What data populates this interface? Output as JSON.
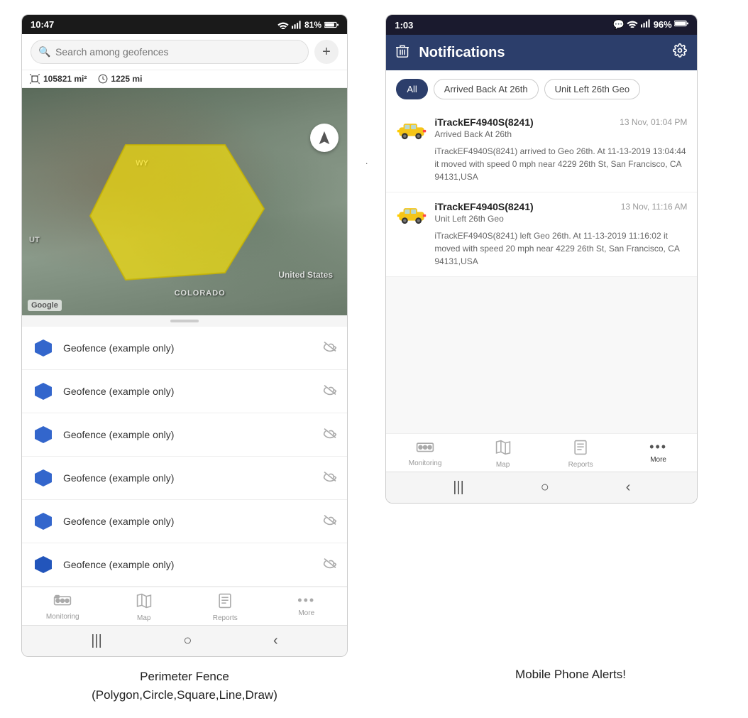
{
  "left_phone": {
    "status_bar": {
      "time": "10:47",
      "wifi": "WiFi",
      "signal": "Signal",
      "battery": "81%"
    },
    "search": {
      "placeholder": "Search among geofences"
    },
    "map_stats": {
      "area": "105821 mi²",
      "distance": "1225 mi"
    },
    "map_labels": {
      "wy": "WY",
      "ut": "UT",
      "colorado": "COLORADO",
      "us": "United States"
    },
    "geofence_items": [
      {
        "name": "Geofence (example only)"
      },
      {
        "name": "Geofence (example only)"
      },
      {
        "name": "Geofence (example only)"
      },
      {
        "name": "Geofence (example only)"
      },
      {
        "name": "Geofence (example only)"
      },
      {
        "name": "Geofence (example only)"
      }
    ],
    "bottom_nav": [
      {
        "label": "Monitoring",
        "icon": "🚌"
      },
      {
        "label": "Map",
        "icon": "🗺"
      },
      {
        "label": "Reports",
        "icon": "📊"
      },
      {
        "label": "More",
        "icon": "···"
      }
    ],
    "android_nav": [
      "|||",
      "○",
      "<"
    ]
  },
  "right_phone": {
    "status_bar": {
      "time": "1:03",
      "chat_icon": "💬",
      "wifi": "WiFi",
      "signal": "Signal",
      "battery": "96%"
    },
    "header": {
      "title": "Notifications",
      "delete_icon": "🗑",
      "settings_icon": "⚙"
    },
    "filter_chips": [
      {
        "label": "All",
        "active": true
      },
      {
        "label": "Arrived Back At 26th",
        "active": false
      },
      {
        "label": "Unit Left 26th Geo",
        "active": false
      }
    ],
    "notifications": [
      {
        "device": "iTrackEF4940S(8241)",
        "timestamp": "13 Nov, 01:04 PM",
        "subtitle": "Arrived Back At 26th",
        "body": "iTrackEF4940S(8241) arrived to Geo 26th.    At 11-13-2019 13:04:44 it moved with speed 0 mph near 4229 26th St, San Francisco, CA 94131,USA"
      },
      {
        "device": "iTrackEF4940S(8241)",
        "timestamp": "13 Nov, 11:16 AM",
        "subtitle": "Unit Left 26th Geo",
        "body": "iTrackEF4940S(8241) left Geo 26th.    At 11-13-2019 11:16:02 it moved with speed 20 mph near 4229 26th St, San Francisco, CA 94131,USA"
      }
    ],
    "bottom_nav": [
      {
        "label": "Monitoring",
        "icon": "🚌"
      },
      {
        "label": "Map",
        "icon": "🗺"
      },
      {
        "label": "Reports",
        "icon": "📊"
      },
      {
        "label": "More",
        "icon": "···"
      }
    ],
    "android_nav": [
      "|||",
      "○",
      "<"
    ]
  },
  "captions": {
    "left": "Perimeter Fence\n(Polygon,Circle,Square,Line,Draw)",
    "right": "Mobile Phone Alerts!"
  },
  "separator_dot": "."
}
